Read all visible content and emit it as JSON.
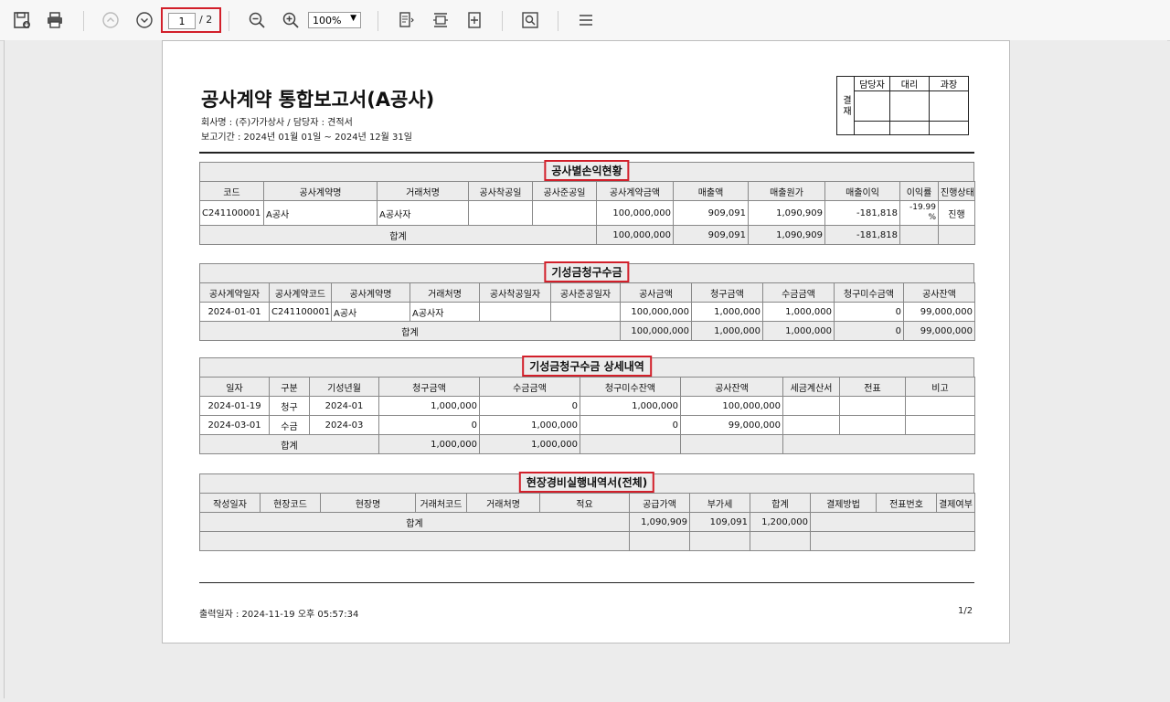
{
  "toolbar": {
    "page_current": "1",
    "page_total": "/ 2",
    "zoom": "100%"
  },
  "report": {
    "title": "공사계약 통합보고서(A공사)",
    "company_line": "회사명 : (주)가가상사 / 담당자 : 견적서",
    "period_line": "보고기간 : 2024년 01월 01일  ~ 2024년 12월 31일",
    "approval": {
      "side": "결재",
      "cols": [
        "담당자",
        "대리",
        "과장"
      ]
    },
    "print_date": "출력일자 : 2024-11-19   오후  05:57:34",
    "page_indicator": "1/2"
  },
  "section1": {
    "title": "공사별손익현황",
    "headers": [
      "코드",
      "공사계약명",
      "거래처명",
      "공사착공일",
      "공사준공일",
      "공사계약금액",
      "매출액",
      "매출원가",
      "매출이익",
      "이익률",
      "진행상태"
    ],
    "row": [
      "C241100001",
      "A공사",
      "A공사자",
      "",
      "",
      "100,000,000",
      "909,091",
      "1,090,909",
      "-181,818",
      "-19.99 %",
      "진행"
    ],
    "sum_label": "합계",
    "sum": [
      "100,000,000",
      "909,091",
      "1,090,909",
      "-181,818"
    ]
  },
  "section2": {
    "title": "기성금청구수금",
    "headers": [
      "공사계약일자",
      "공사계약코드",
      "공사계약명",
      "거래처명",
      "공사착공일자",
      "공사준공일자",
      "공사금액",
      "청구금액",
      "수금금액",
      "청구미수금액",
      "공사잔액"
    ],
    "row": [
      "2024-01-01",
      "C241100001",
      "A공사",
      "A공사자",
      "",
      "",
      "100,000,000",
      "1,000,000",
      "1,000,000",
      "0",
      "99,000,000"
    ],
    "sum_label": "합계",
    "sum": [
      "100,000,000",
      "1,000,000",
      "1,000,000",
      "0",
      "99,000,000"
    ]
  },
  "section3": {
    "title": "기성금청구수금 상세내역",
    "headers": [
      "일자",
      "구분",
      "기성년월",
      "청구금액",
      "수금금액",
      "청구미수잔액",
      "공사잔액",
      "세금계산서",
      "전표",
      "비고"
    ],
    "rows": [
      [
        "2024-01-19",
        "청구",
        "2024-01",
        "1,000,000",
        "0",
        "1,000,000",
        "100,000,000",
        "",
        "",
        ""
      ],
      [
        "2024-03-01",
        "수금",
        "2024-03",
        "0",
        "1,000,000",
        "0",
        "99,000,000",
        "",
        "",
        ""
      ]
    ],
    "sum_label": "합계",
    "sum": [
      "1,000,000",
      "1,000,000"
    ]
  },
  "section4": {
    "title": "현장경비실행내역서(전체)",
    "headers": [
      "작성일자",
      "현장코드",
      "현장명",
      "거래처코드",
      "거래처명",
      "적요",
      "공급가액",
      "부가세",
      "합계",
      "결제방법",
      "전표번호",
      "결제여부"
    ],
    "sum_label": "합계",
    "sum": [
      "1,090,909",
      "109,091",
      "1,200,000"
    ]
  }
}
